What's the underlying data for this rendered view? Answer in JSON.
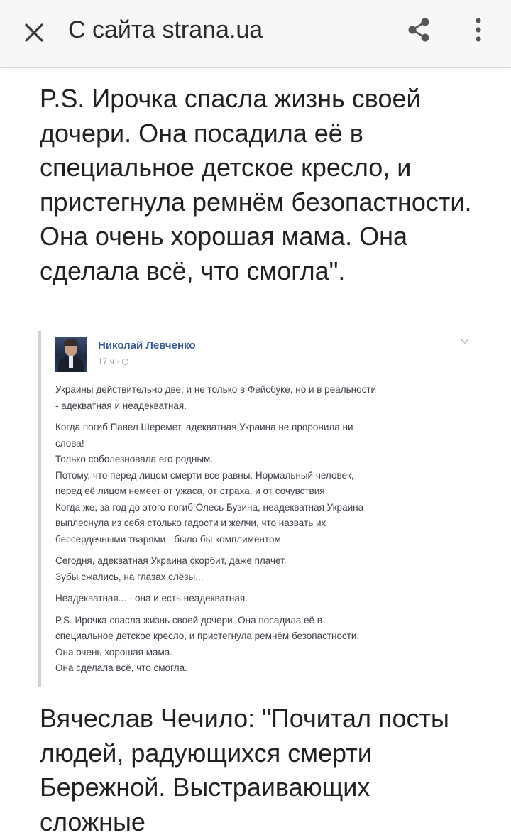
{
  "appbar": {
    "title": "С сайта strana.ua",
    "close_icon": "close-icon",
    "share_icon": "share-icon",
    "menu_icon": "more-vertical-icon"
  },
  "article": {
    "paragraph_1": "P.S. Ирочка спасла жизнь своей дочери. Она посадила её в специальное детское кресло, и пристегнула ремнём безопастности. Она очень хорошая мама. Она сделала всё, что смогла\".",
    "paragraph_2": "Вячеслав Чечило: \"Почитал посты людей, радующихся смерти Бережной. Выстраивающих сложные"
  },
  "fb_post": {
    "author": "Николай Левченко",
    "time": "17 ч ·",
    "lines": [
      [
        "Украины действительно две, и не только в Фейсбуке, но и в реальности",
        "- адекватная и неадекватная."
      ],
      [
        "Когда погиб Павел Шеремет, адекватная Украина не проронила ни",
        "слова!",
        "Только соболезновала его родным.",
        "Потому, что перед лицом смерти все равны. Нормальный человек,",
        "перед её лицом немеет от ужаса, от страха, и от сочувствия.",
        "Когда же, за год до этого погиб Олесь Бузина, неадекватная Украина",
        "выплеснула из себя столько гадости и желчи, что назвать их",
        "бессердечными тварями - было бы комплиментом."
      ],
      [
        "Сегодня, адекватная Украина скорбит, даже плачет.",
        "Зубы сжались, на глазах слёзы..."
      ],
      [
        "Неадекватная... - она и есть неадекватная."
      ],
      [
        "P.S. Ирочка спасла жизнь своей дочери. Она посадила её в",
        "специальное детское кресло, и пристегнула ремнём безопастности.",
        "Она очень хорошая мама.",
        "Она сделала всё, что смогла."
      ]
    ]
  }
}
